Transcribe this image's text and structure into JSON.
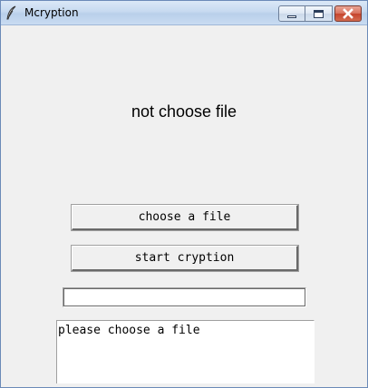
{
  "window": {
    "title": "Mcryption",
    "icon": "feather-icon",
    "controls": {
      "minimize_icon": "minimize-icon",
      "maximize_icon": "maximize-icon",
      "close_icon": "close-icon"
    }
  },
  "main": {
    "status_text": "not choose file",
    "choose_button_label": "choose a file",
    "start_button_label": "start cryption",
    "entry_value": "",
    "log_text": "please choose a file"
  },
  "colors": {
    "background": "#f0f0f0",
    "title_bar": "#c7daf0",
    "close_button": "#c5442d"
  }
}
